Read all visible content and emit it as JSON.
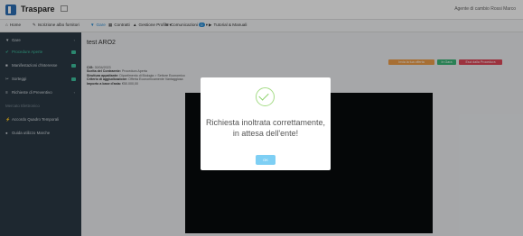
{
  "app": {
    "title": "Traspare",
    "user": "Agente di cambio Rossi Marco"
  },
  "nav": {
    "items": [
      {
        "icon": "home-icon",
        "glyph": "⌂",
        "label": "Home"
      },
      {
        "icon": "wrench-icon",
        "glyph": "✎",
        "label": "Iscrizione albo fornitori"
      },
      {
        "icon": "filter-icon",
        "glyph": "▼",
        "label": "Gare",
        "active": true
      },
      {
        "icon": "list-icon",
        "glyph": "▦",
        "label": "Contratti"
      },
      {
        "icon": "user-icon",
        "glyph": "▲",
        "label": "Gestione Profilo",
        "chevron": true
      },
      {
        "icon": "chat-icon",
        "glyph": "✉",
        "label": "Comunicazioni",
        "badge": "0",
        "chevron": true
      },
      {
        "icon": "video-icon",
        "glyph": "▶",
        "label": "Tutorial & Manuali"
      }
    ]
  },
  "sidebar": {
    "items": [
      {
        "icon": "filter-icon",
        "glyph": "▼",
        "label": "Gare",
        "chevron": true
      },
      {
        "icon": "check-icon",
        "glyph": "✔",
        "label": "Procedure Aperte",
        "active": true,
        "badge": true
      },
      {
        "icon": "flag-icon",
        "glyph": "■",
        "label": "Manifestazioni d'interesse",
        "badge": true
      },
      {
        "icon": "tag-icon",
        "glyph": "✂",
        "label": "Sorteggi",
        "badge": true
      },
      {
        "icon": "bars-icon",
        "glyph": "≡",
        "label": "Richieste di Preventivo",
        "chevron": true
      },
      {
        "label": "Mercato Elettronico",
        "section": true
      },
      {
        "icon": "bolt-icon",
        "glyph": "⚡",
        "label": "Accordo Quadro Temporali"
      },
      {
        "icon": "dot-icon",
        "glyph": "●",
        "label": "Guida utilizzo Marche"
      }
    ]
  },
  "page": {
    "title": "test ARO2",
    "info": [
      {
        "label": "CIG:",
        "value": "30/04/2023"
      },
      {
        "label": "Scelta del Contraente:",
        "value": "Procedura Aperta"
      },
      {
        "label": "Struttura appaltante:",
        "value": "Dipartimento di Biologia > Settore Economico"
      },
      {
        "label": "Criterio di aggiudicazione:",
        "value": "Offerta Economicamente Vantaggiosa"
      },
      {
        "label": "Importo a base d'asta:",
        "value": "€50.000,00"
      }
    ],
    "buttons": {
      "orange": "Invia la tua offerta",
      "green": "In Gara",
      "red": "Esci dalla Procedura"
    }
  },
  "modal": {
    "line1": "Richiesta inoltrata correttamente,",
    "line2": "in attesa dell'ente!",
    "ok": "OK"
  }
}
